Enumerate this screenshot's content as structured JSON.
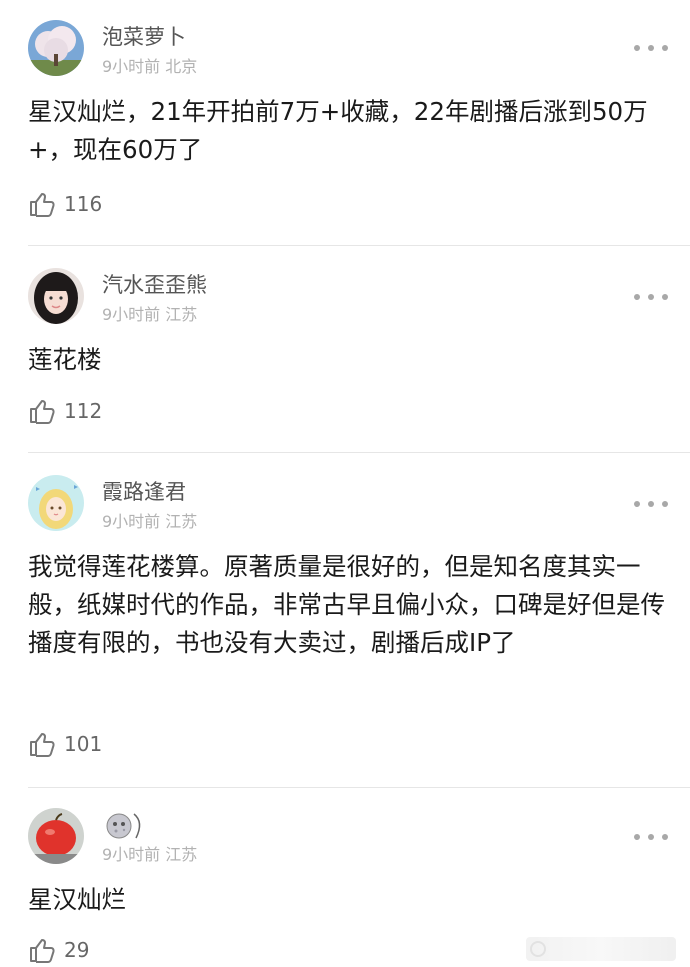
{
  "comments": [
    {
      "name": "泡菜萝卜",
      "meta": "9小时前 北京",
      "text": "星汉灿烂，21年开拍前7万+收藏，22年剧播后涨到50万+，现在60万了",
      "likes": "116",
      "avatar_icon": "tree-avatar-icon"
    },
    {
      "name": "汽水歪歪熊",
      "meta": "9小时前 江苏",
      "text": "莲花楼",
      "likes": "112",
      "avatar_icon": "girl-photo-avatar-icon"
    },
    {
      "name": "霞路逢君",
      "meta": "9小时前 江苏",
      "text": "我觉得莲花楼算。原著质量是很好的，但是知名度其实一般，纸媒时代的作品，非常古早且偏小众，口碑是好但是传播度有限的，书也没有大卖过，剧播后成IP了",
      "likes": "101",
      "avatar_icon": "cartoon-girl-avatar-icon"
    },
    {
      "name": "",
      "meta": "9小时前 江苏",
      "text": "星汉灿烂",
      "likes": "29",
      "avatar_icon": "apple-avatar-icon",
      "name_icon": "moon-face-emoji-icon"
    }
  ],
  "colors": {
    "name": "#555555",
    "meta": "#b2b2b2",
    "text": "#1a1a1a",
    "divider": "#e6e6e6"
  },
  "icons": {
    "like": "thumbs-up-icon",
    "more": "more-dots-icon"
  }
}
